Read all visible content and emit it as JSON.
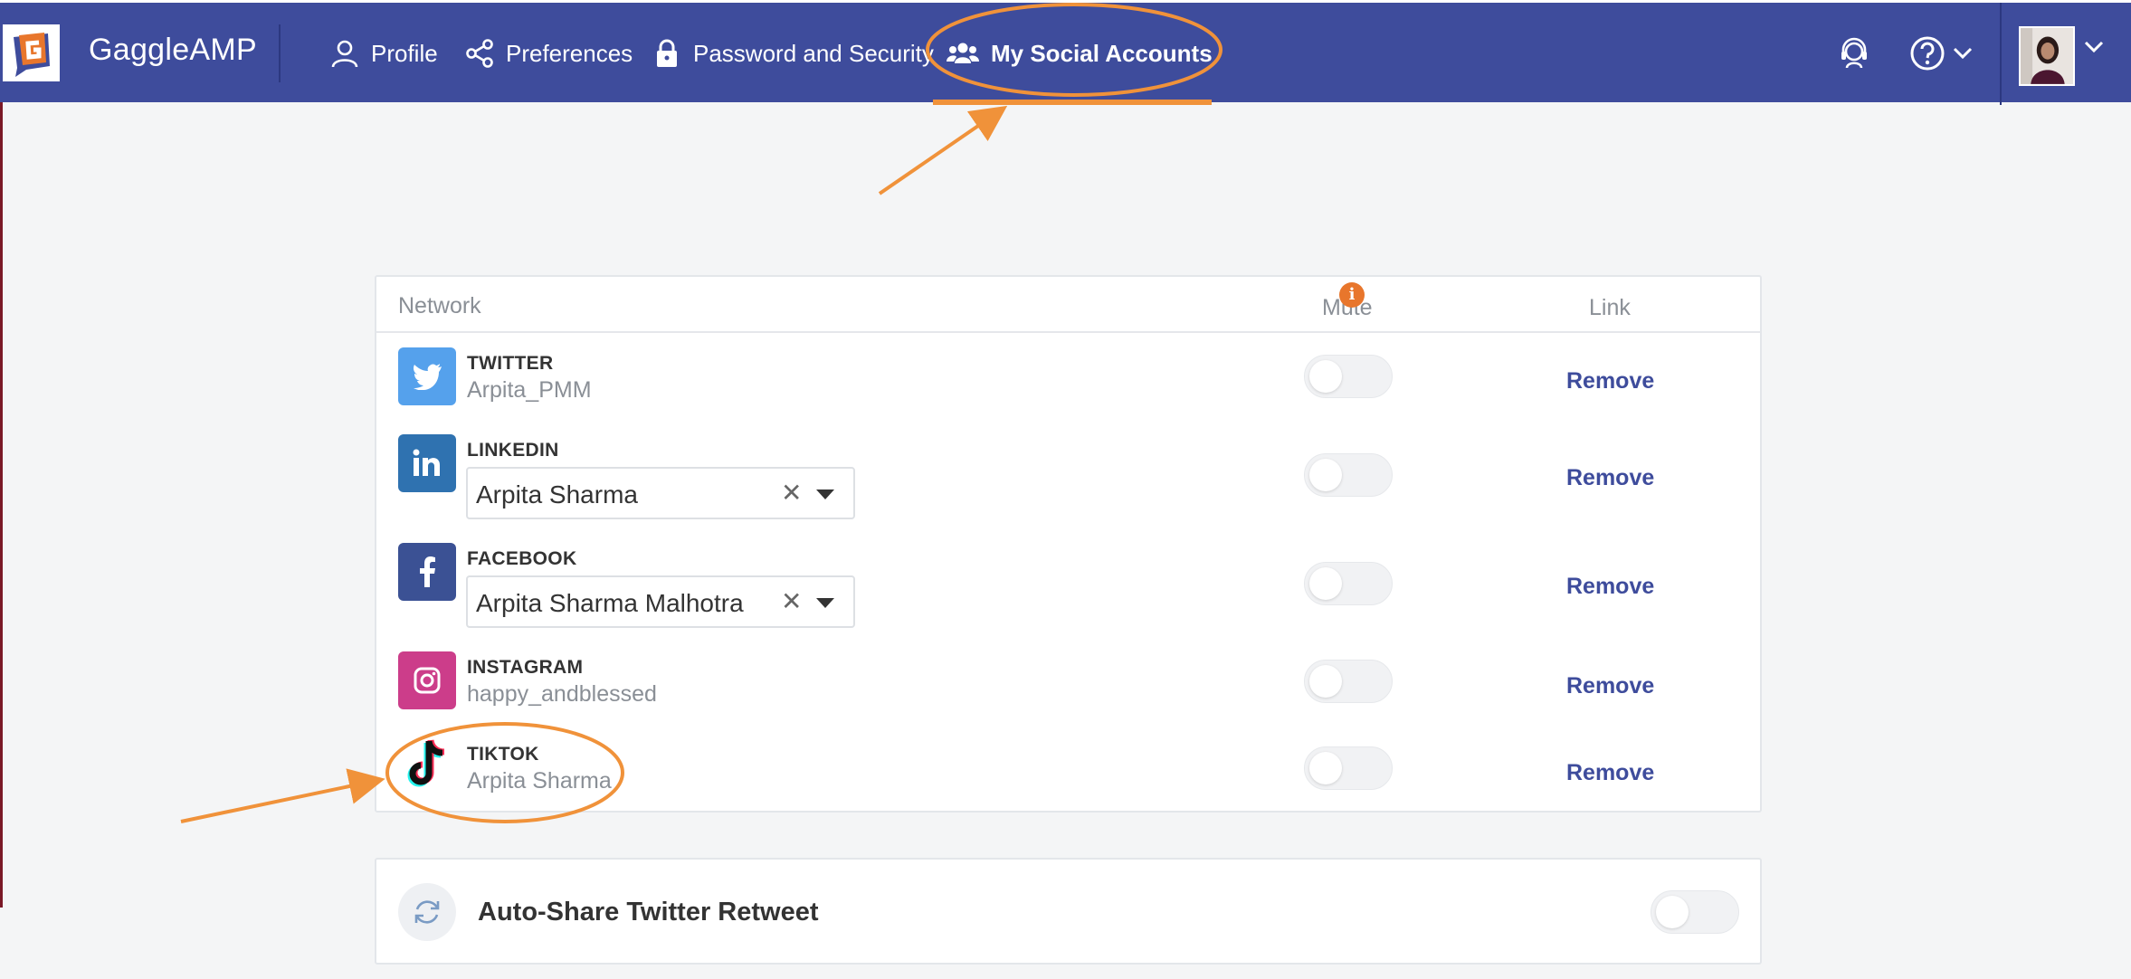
{
  "app": {
    "brand": "GaggleAMP",
    "accent_color": "#3e4c9c",
    "highlight_color": "#f0923a"
  },
  "nav": {
    "items": [
      {
        "label": "Profile",
        "icon": "user-icon"
      },
      {
        "label": "Preferences",
        "icon": "share-icon"
      },
      {
        "label": "Password and Security",
        "icon": "lock-icon"
      },
      {
        "label": "My Social Accounts",
        "icon": "users-icon",
        "active": true
      }
    ],
    "right_icons": [
      "support-agent-icon",
      "help-icon",
      "avatar"
    ]
  },
  "table": {
    "columns": {
      "network": "Network",
      "mute": "Mute",
      "link": "Link"
    },
    "info_badge": "i",
    "rows": [
      {
        "network": "TWITTER",
        "handle": "Arpita_PMM",
        "icon": "twitter-icon",
        "muted": false,
        "action": "Remove"
      },
      {
        "network": "LINKEDIN",
        "selected": "Arpita Sharma",
        "icon": "linkedin-icon",
        "muted": false,
        "action": "Remove"
      },
      {
        "network": "FACEBOOK",
        "selected": "Arpita Sharma Malhotra",
        "icon": "facebook-icon",
        "muted": false,
        "action": "Remove"
      },
      {
        "network": "INSTAGRAM",
        "handle": "happy_andblessed",
        "icon": "instagram-icon",
        "muted": false,
        "action": "Remove"
      },
      {
        "network": "TIKTOK",
        "handle": "Arpita Sharma",
        "icon": "tiktok-icon",
        "muted": false,
        "action": "Remove"
      }
    ],
    "clear_glyph": "✕"
  },
  "auto_share": {
    "title": "Auto-Share Twitter Retweet",
    "icon": "refresh-icon",
    "enabled": false
  }
}
